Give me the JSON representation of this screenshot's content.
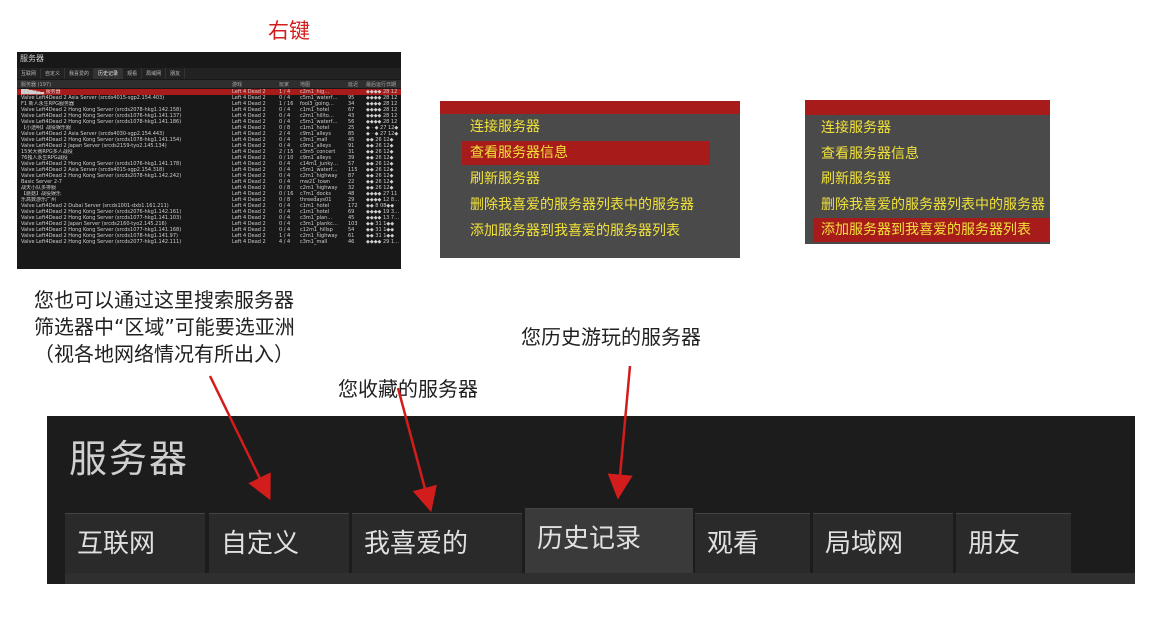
{
  "annotations": {
    "right_click": "右键",
    "search_line1": "您也可以通过这里搜索服务器",
    "search_line2": "筛选器中“区域”可能要选亚洲",
    "search_line3": "（视各地网络情况有所出入）",
    "favorites_note": "您收藏的服务器",
    "history_note": "您历史游玩的服务器"
  },
  "mini_browser": {
    "title": "服务器",
    "tabs": [
      "互联网",
      "自定义",
      "我喜爱的",
      "历史记录",
      "观看",
      "局域网",
      "朋友"
    ],
    "active_tab": 3,
    "headers": {
      "name": "服务器 (197)",
      "game": "游戏",
      "players": "玩家",
      "map": "地图",
      "ping": "延迟",
      "last": "最后运行日期"
    },
    "rows": [
      {
        "name": "█▇▆▅▄▃ 服务器",
        "game": "Left 4 Dead 2",
        "players": "1 / 4",
        "map": "c2m1_hig…",
        "ping": "",
        "last": "◆◆◆◆ 28 12",
        "selected": true
      },
      {
        "name": "Valve Left4Dead 2 Asia Server (srcds4015-sgp2.154.403)",
        "game": "Left 4 Dead 2",
        "players": "0 / 4",
        "map": "c5m1_waterf…",
        "ping": "95",
        "last": "◆◆◆◆ 28 12"
      },
      {
        "name": "F1 新人永生RPG服务器",
        "game": "Left 4 Dead 2",
        "players": "1 / 16",
        "map": "fool3_going…",
        "ping": "34",
        "last": "◆◆◆◆ 28 12"
      },
      {
        "name": "Valve Left4Dead 2 Hong Kong Server (srcds2078-hkg1.142.158)",
        "game": "Left 4 Dead 2",
        "players": "0 / 4",
        "map": "c1m1_hotel",
        "ping": "67",
        "last": "◆◆◆◆ 28 12"
      },
      {
        "name": "Valve Left4Dead 2 Hong Kong Server (srcds1076-hkg1.141.137)",
        "game": "Left 4 Dead 2",
        "players": "0 / 4",
        "map": "c2m1_hillto…",
        "ping": "43",
        "last": "◆◆◆◆ 28 12"
      },
      {
        "name": "Valve Left4Dead 2 Hong Kong Server (srcds1078-hkg1.141.186)",
        "game": "Left 4 Dead 2",
        "players": "0 / 4",
        "map": "c5m1_waterf…",
        "ping": "56",
        "last": "◆◆◆◆ 28 12"
      },
      {
        "name": "【小透明】战役娱乐服",
        "game": "Left 4 Dead 2",
        "players": "0 / 8",
        "map": "c1m1_hotel",
        "ping": "25",
        "last": "◆ · ◆ 27 12◆"
      },
      {
        "name": "Valve Left4Dead 2 Asia Server (srcds4030-sgp2.154.443)",
        "game": "Left 4 Dead 2",
        "players": "2 / 4",
        "map": "c9m1_alleys",
        "ping": "85",
        "last": "◆ · ◆ 27 12◆"
      },
      {
        "name": "Valve Left4Dead 2 Hong Kong Server (srcds1078-hkg1.141.154)",
        "game": "Left 4 Dead 2",
        "players": "0 / 4",
        "map": "c3m1_mall",
        "ping": "45",
        "last": "◆◆ 26 12◆"
      },
      {
        "name": "Valve Left4Dead 2 Japan Server (srcds2159-tyo2.145.134)",
        "game": "Left 4 Dead 2",
        "players": "0 / 4",
        "map": "c9m1_alleys",
        "ping": "91",
        "last": "◆◆ 26 12◆"
      },
      {
        "name": "15米大赛RPG多人战役",
        "game": "Left 4 Dead 2",
        "players": "2 / 15",
        "map": "c3m5_concert",
        "ping": "31",
        "last": "◆◆ 26 12◆"
      },
      {
        "name": "76独人永生RPG战役",
        "game": "Left 4 Dead 2",
        "players": "0 / 10",
        "map": "c9m1_alleys",
        "ping": "39",
        "last": "◆◆ 26 12◆"
      },
      {
        "name": "Valve Left4Dead 2 Hong Kong Server (srcds1076-hkg1.141.178)",
        "game": "Left 4 Dead 2",
        "players": "0 / 4",
        "map": "c14m1_junky…",
        "ping": "57",
        "last": "◆◆ 26 12◆"
      },
      {
        "name": "Valve Left4Dead 2 Asia Server (srcds4015-sgp2.154.318)",
        "game": "Left 4 Dead 2",
        "players": "0 / 4",
        "map": "c5m1_waterf…",
        "ping": "115",
        "last": "◆◆ 26 12◆"
      },
      {
        "name": "Valve Left4Dead 2 Hong Kong Server (srcds2078-hkg1.142.242)",
        "game": "Left 4 Dead 2",
        "players": "0 / 4",
        "map": "c2m1_highway",
        "ping": "87",
        "last": "◆◆ 26 12◆"
      },
      {
        "name": "Basic Server 2-7",
        "game": "Left 4 Dead 2",
        "players": "0 / 4",
        "map": "mw21_town",
        "ping": "22",
        "last": "◆◆ 26 12◆"
      },
      {
        "name": "战天小队多排服",
        "game": "Left 4 Dead 2",
        "players": "0 / 8",
        "map": "c2m1_highway",
        "ping": "32",
        "last": "◆◆ 26 12◆"
      },
      {
        "name": "【蘑菇】战役娱乐",
        "game": "Left 4 Dead 2",
        "players": "0 / 16",
        "map": "c7m1_docks",
        "ping": "48",
        "last": "◆◆◆◆ 27 11"
      },
      {
        "name": "乐高数游乐广州",
        "game": "Left 4 Dead 2",
        "players": "0 / 8",
        "map": "threedays01",
        "ping": "29",
        "last": "◆◆◆◆ 12 8…"
      },
      {
        "name": "Valve Left4Dead 2 Dubai Server (srcds1001-dxb1.161.211)",
        "game": "Left 4 Dead 2",
        "players": "0 / 4",
        "map": "c1m1_hotel",
        "ping": "172",
        "last": "◆◆ 8 08◆◆"
      },
      {
        "name": "Valve Left4Dead 2 Hong Kong Server (srcds2076-hkg1.142.161)",
        "game": "Left 4 Dead 2",
        "players": "0 / 4",
        "map": "c1m1_hotel",
        "ping": "69",
        "last": "◆◆◆◆ 19 3…"
      },
      {
        "name": "Valve Left4Dead 2 Hong Kong Server (srcds1077-hkg1.141.103)",
        "game": "Left 4 Dead 2",
        "players": "0 / 4",
        "map": "c3m1_plan…",
        "ping": "45",
        "last": "◆◆◆◆ 13 7…"
      },
      {
        "name": "Valve Left4Dead 2 Japan Server (srcds2160-tyo2.145.216)",
        "game": "Left 4 Dead 2",
        "players": "0 / 4",
        "map": "c3m1_plankc…",
        "ping": "103",
        "last": "◆◆ 31 1◆◆"
      },
      {
        "name": "Valve Left4Dead 2 Hong Kong Server (srcds1077-hkg1.141.168)",
        "game": "Left 4 Dead 2",
        "players": "0 / 4",
        "map": "c12m1_hillsp",
        "ping": "54",
        "last": "◆◆ 31 1◆◆"
      },
      {
        "name": "Valve Left4Dead 2 Hong Kong Server (srcds1078-hkg1.141.97)",
        "game": "Left 4 Dead 2",
        "players": "1 / 4",
        "map": "c2m1_highway",
        "ping": "61",
        "last": "◆◆ 31 1◆◆"
      },
      {
        "name": "Valve Left4Dead 2 Hong Kong Server (srcds2077-hkg1.142.111)",
        "game": "Left 4 Dead 2",
        "players": "4 / 4",
        "map": "c3m1_mall",
        "ping": "46",
        "last": "◆◆◆◆ 29 1…"
      }
    ]
  },
  "context_menu_1": {
    "items": [
      "连接服务器",
      "查看服务器信息",
      "刷新服务器",
      "删除我喜爱的服务器列表中的服务器",
      "添加服务器到我喜爱的服务器列表"
    ],
    "highlighted": 1
  },
  "context_menu_2": {
    "items": [
      "连接服务器",
      "查看服务器信息",
      "刷新服务器",
      "删除我喜爱的服务器列表中的服务器",
      "添加服务器到我喜爱的服务器列表"
    ],
    "highlighted": 4
  },
  "big_tabs": {
    "title": "服务器",
    "tabs": [
      "互联网",
      "自定义",
      "我喜爱的",
      "历史记录",
      "观看",
      "局域网",
      "朋友"
    ],
    "active_tab": 3
  },
  "colors": {
    "annotation_red": "#d31c1c",
    "highlight_red": "#a81b1b",
    "menu_text": "#f2e23a",
    "menu_bg": "#4a4a4a"
  }
}
